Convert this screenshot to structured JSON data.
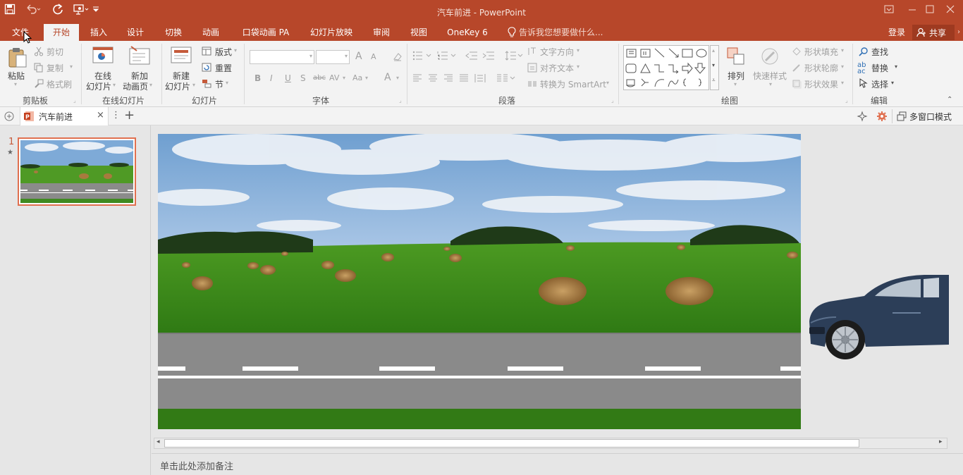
{
  "titlebar": {
    "app_title": "汽车前进 - PowerPoint",
    "quick_access": [
      "save-icon",
      "undo-icon",
      "redo-icon",
      "present-icon",
      "customize-icon"
    ],
    "window_buttons": [
      "ribbon-display-icon",
      "minimize-icon",
      "maximize-icon",
      "close-icon"
    ]
  },
  "tabs": {
    "file": "文件",
    "home": "开始",
    "insert": "插入",
    "design": "设计",
    "transitions": "切换",
    "animations": "动画",
    "pocket_animation": "口袋动画 PA",
    "slideshow": "幻灯片放映",
    "review": "审阅",
    "view": "视图",
    "onekey": "OneKey 6",
    "tell_me": "告诉我您想要做什么...",
    "login": "登录",
    "share": "共享"
  },
  "ribbon": {
    "clipboard": {
      "paste": "粘贴",
      "cut": "剪切",
      "copy": "复制",
      "format_painter": "格式刷",
      "group": "剪贴板"
    },
    "online_slides": {
      "online_line1": "在线",
      "online_line2": "幻灯片",
      "new_anim_line1": "新加",
      "new_anim_line2": "动画页",
      "group": "在线幻灯片"
    },
    "slides": {
      "new_line1": "新建",
      "new_line2": "幻灯片",
      "layout": "版式",
      "reset": "重置",
      "section": "节",
      "group": "幻灯片"
    },
    "font": {
      "bold": "B",
      "italic": "I",
      "underline": "U",
      "shadow": "S",
      "strike": "abc",
      "spacing": "AV",
      "case": "Aa",
      "color": "A",
      "grow": "A",
      "shrink": "A",
      "group": "字体"
    },
    "paragraph": {
      "text_direction": "文字方向",
      "align_text": "对齐文本",
      "smartart": "转换为 SmartArt",
      "group": "段落"
    },
    "drawing": {
      "arrange": "排列",
      "quick_styles": "快速样式",
      "shape_fill": "形状填充",
      "shape_outline": "形状轮廓",
      "shape_effects": "形状效果",
      "group": "绘图"
    },
    "editing": {
      "find": "查找",
      "replace": "替换",
      "select": "选择",
      "group": "编辑"
    }
  },
  "doc_tabs": {
    "active_tab": "汽车前进",
    "multi_window": "多窗口模式"
  },
  "thumbnails": [
    {
      "number": "1"
    }
  ],
  "notes": {
    "placeholder": "单击此处添加备注"
  },
  "colors": {
    "accent": "#b7472a",
    "ribbon_bg": "#f3f3f3",
    "selection": "#e07050"
  }
}
